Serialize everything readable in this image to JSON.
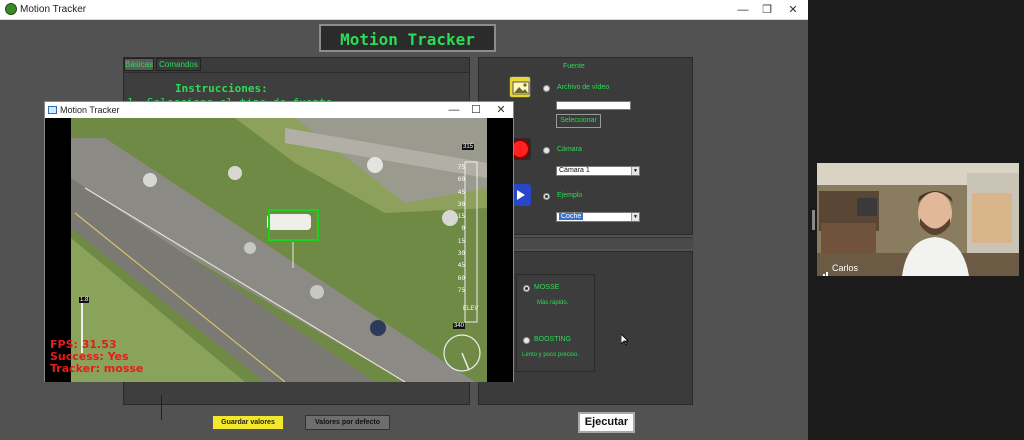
{
  "main_window": {
    "title": "Motion Tracker",
    "app_title": "Motion Tracker",
    "tabs": [
      "Básicas",
      "Comandos"
    ],
    "instructions_title": "Instrucciones:",
    "instructions_line1": "1.  Seleccione el tipo de fuente"
  },
  "source": {
    "title": "Fuente",
    "options": [
      {
        "label": "Archivo de vídeo",
        "checked": false
      },
      {
        "label": "Cámara",
        "checked": false
      },
      {
        "label": "Ejemplo",
        "checked": true
      }
    ],
    "file_value": "",
    "select_button": "Seleccionar",
    "camera_value": "Cámara 1",
    "example_value": "Coche"
  },
  "tracker": {
    "options": [
      {
        "label": "MOSSE",
        "desc": "Más rápido.",
        "checked": true
      },
      {
        "label": "BOOSTING",
        "desc": "Lento y poco preciso.",
        "checked": false
      }
    ]
  },
  "buttons": {
    "save": "Guardar valores",
    "default": "Valores por defecto",
    "run": "Ejecutar"
  },
  "video_window": {
    "title": "Motion Tracker",
    "fps": "FPS: 31.53",
    "success": "Success: Yes",
    "tracker": "Tracker: mosse",
    "scale_top": "315",
    "scale_labels": [
      "75",
      "60",
      "45",
      "30",
      "15",
      "0",
      "15",
      "30",
      "45",
      "60",
      "75"
    ],
    "elev": "ELEV",
    "heading": "340",
    "small_label": "1.8"
  },
  "participant": {
    "name": "Carlos"
  },
  "colors": {
    "accent": "#2ddc55",
    "panel": "#3b3b3b",
    "save_button": "#f3e82b",
    "overlay_text": "#e41c1c"
  }
}
